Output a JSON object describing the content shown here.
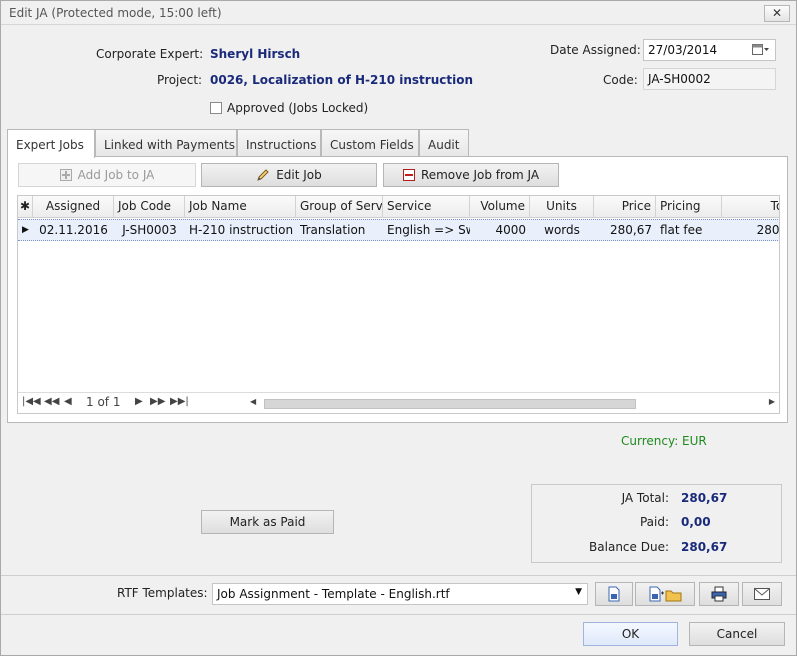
{
  "window": {
    "title": "Edit JA (Protected mode, 15:00 left)",
    "close_glyph": "✕"
  },
  "header": {
    "corporate_expert_label": "Corporate Expert:",
    "corporate_expert_value": "Sheryl Hirsch",
    "project_label": "Project:",
    "project_value": "0026, Localization of H-210 instruction",
    "approved_label": "Approved (Jobs Locked)",
    "approved_checked": false,
    "date_assigned_label": "Date Assigned:",
    "date_assigned_value": "27/03/2014",
    "code_label": "Code:",
    "code_value": "JA-SH0002"
  },
  "tabs": [
    "Expert Jobs",
    "Linked with Payments",
    "Instructions",
    "Custom Fields",
    "Audit"
  ],
  "toolbar": {
    "add_label": "Add Job to JA",
    "edit_label": "Edit Job",
    "remove_label": "Remove Job from JA"
  },
  "grid": {
    "star": "✱",
    "columns": [
      "Assigned",
      "Job Code",
      "Job Name",
      "Group of Serv",
      "Service",
      "Volume",
      "Units",
      "Price",
      "Pricing",
      "Tot"
    ],
    "rows": [
      [
        "02.11.2016",
        "J-SH0003",
        "H-210 instruction t",
        "Translation",
        "English => Sw",
        "4000",
        "words",
        "280,67",
        "flat fee",
        "280,("
      ]
    ],
    "pager": "1 of 1"
  },
  "currency": {
    "label": "Currency:",
    "value": "EUR",
    "color": "#1e8a1e"
  },
  "mark_paid_label": "Mark as Paid",
  "totals": {
    "ja_total_label": "JA Total:",
    "ja_total_value": "280,67",
    "paid_label": "Paid:",
    "paid_value": "0,00",
    "balance_label": "Balance Due:",
    "balance_value": "280,67"
  },
  "rtf": {
    "label": "RTF Templates:",
    "selected": "Job Assignment - Template - English.rtf"
  },
  "footer": {
    "ok_label": "OK",
    "cancel_label": "Cancel"
  },
  "colors": {
    "accent_value": "#1a2a7a",
    "selected_row": "#e9f0fb"
  }
}
